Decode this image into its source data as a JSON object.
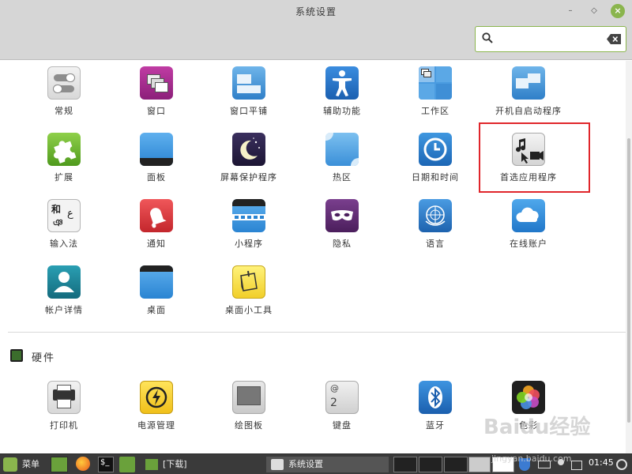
{
  "window": {
    "title": "系统设置"
  },
  "search": {
    "placeholder": ""
  },
  "sections": {
    "personal_items": [
      {
        "label": "常规",
        "icon": "toggle-icon"
      },
      {
        "label": "窗口",
        "icon": "windows-icon"
      },
      {
        "label": "窗口平铺",
        "icon": "tiling-icon"
      },
      {
        "label": "辅助功能",
        "icon": "accessibility-icon"
      },
      {
        "label": "工作区",
        "icon": "workspace-icon"
      },
      {
        "label": "开机自启动程序",
        "icon": "startup-icon"
      },
      {
        "label": "扩展",
        "icon": "puzzle-icon"
      },
      {
        "label": "面板",
        "icon": "panel-icon"
      },
      {
        "label": "屏幕保护程序",
        "icon": "moon-icon"
      },
      {
        "label": "热区",
        "icon": "hotcorner-icon"
      },
      {
        "label": "日期和时间",
        "icon": "clock-icon"
      },
      {
        "label": "首选应用程序",
        "icon": "preferred-apps-icon"
      },
      {
        "label": "输入法",
        "icon": "input-method-icon"
      },
      {
        "label": "通知",
        "icon": "bell-icon"
      },
      {
        "label": "小程序",
        "icon": "applets-icon"
      },
      {
        "label": "隐私",
        "icon": "mask-icon"
      },
      {
        "label": "语言",
        "icon": "globe-icon"
      },
      {
        "label": "在线账户",
        "icon": "cloud-icon"
      },
      {
        "label": "帐户详情",
        "icon": "user-icon"
      },
      {
        "label": "桌面",
        "icon": "desktop-icon"
      },
      {
        "label": "桌面小工具",
        "icon": "desklet-icon"
      }
    ],
    "hardware": {
      "title": "硬件",
      "items": [
        {
          "label": "打印机",
          "icon": "printer-icon"
        },
        {
          "label": "电源管理",
          "icon": "power-icon"
        },
        {
          "label": "绘图板",
          "icon": "tablet-icon"
        },
        {
          "label": "键盘",
          "icon": "keyboard-icon"
        },
        {
          "label": "蓝牙",
          "icon": "bluetooth-icon"
        },
        {
          "label": "色彩",
          "icon": "color-icon"
        }
      ]
    }
  },
  "taskbar": {
    "menu_label": "菜单",
    "downloads_label": "[下载]",
    "settings_window_label": "系统设置",
    "clock": "01:45"
  },
  "watermark": {
    "brand": "Baidu经验",
    "url": "jingyan.baidu.com"
  },
  "colors": {
    "accent": "#8ab54d",
    "highlight_border": "#e0262b",
    "taskbar": "#3a3a3a"
  }
}
